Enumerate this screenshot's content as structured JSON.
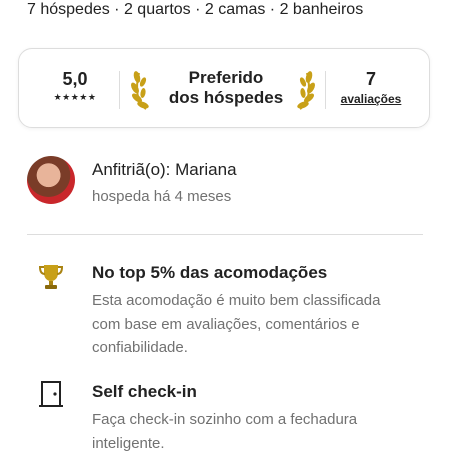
{
  "listing": {
    "summary": "7 hóspedes · 2 quartos · 2 camas · 2 banheiros"
  },
  "highlight_card": {
    "rating": "5,0",
    "stars": "★★★★★",
    "guest_favorite_line1": "Preferido",
    "guest_favorite_line2": "dos hóspedes",
    "reviews_count": "7",
    "reviews_label": "avaliações"
  },
  "host": {
    "title": "Anfitriã(o): Mariana",
    "subtitle": "hospeda há 4 meses"
  },
  "features": [
    {
      "icon": "trophy-icon",
      "title": "No top 5% das acomodações",
      "description": "Esta acomodação é muito bem classificada com base em avaliações, comentários e confiabilidade."
    },
    {
      "icon": "door-icon",
      "title": "Self check-in",
      "description": "Faça check-in sozinho com a fechadura inteligente."
    }
  ],
  "colors": {
    "text": "#222222",
    "muted": "#717171",
    "divider": "#dddddd",
    "trophy": "#c8a018"
  }
}
